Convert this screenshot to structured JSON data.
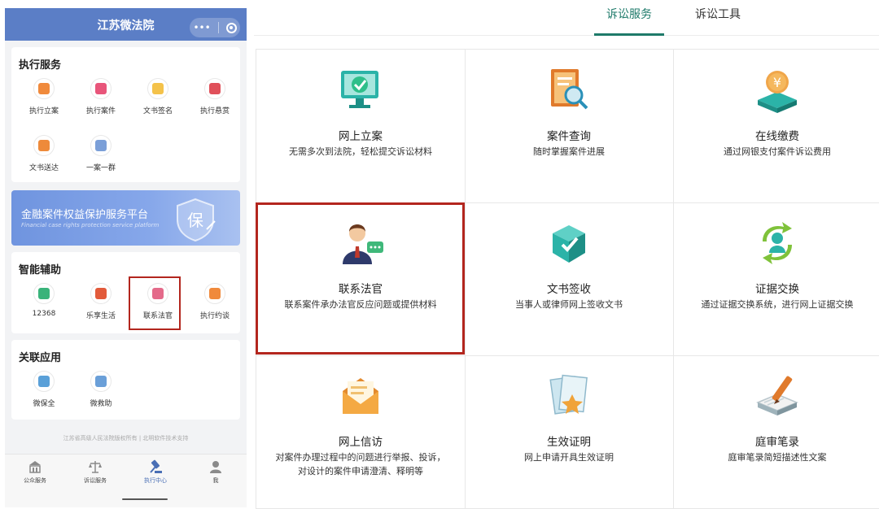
{
  "phone": {
    "title": "江苏微法院",
    "capsule_more": "•••",
    "execution": {
      "title": "执行服务",
      "items": [
        {
          "label": "执行立案",
          "icon": "file-orange-icon",
          "color": "#f08a3c"
        },
        {
          "label": "执行案件",
          "icon": "gavel-pink-icon",
          "color": "#e8557a"
        },
        {
          "label": "文书签名",
          "icon": "document-yellow-icon",
          "color": "#f4c24a"
        },
        {
          "label": "执行悬赏",
          "icon": "reward-red-icon",
          "color": "#e0505a"
        },
        {
          "label": "文书送达",
          "icon": "envelope-orange-icon",
          "color": "#ee8a3a"
        },
        {
          "label": "一案一群",
          "icon": "group-blue-icon",
          "color": "#7b9fd8"
        }
      ]
    },
    "banner": {
      "title": "金融案件权益保护服务平台",
      "subtitle": "Financial case rights protection service platform",
      "shield_char": "保"
    },
    "assist": {
      "title": "智能辅助",
      "items": [
        {
          "label": "12368",
          "icon": "phone-green-icon",
          "color": "#39b37a"
        },
        {
          "label": "乐享生活",
          "icon": "life-red-icon",
          "color": "#e25a3a"
        },
        {
          "label": "联系法官",
          "icon": "judge-pink-icon",
          "color": "#e46a8a"
        },
        {
          "label": "执行约谈",
          "icon": "video-orange-icon",
          "color": "#f08a3c"
        }
      ]
    },
    "related": {
      "title": "关联应用",
      "items": [
        {
          "label": "微保全",
          "icon": "wing-blue-icon",
          "color": "#5aa0d8"
        },
        {
          "label": "微救助",
          "icon": "help-blue-icon",
          "color": "#6a9fd8"
        }
      ]
    },
    "footer_note": "江苏省高级人民法院版权所有 | 北明软件技术支持",
    "tabbar": [
      {
        "label": "公众服务",
        "icon": "building-icon"
      },
      {
        "label": "诉讼服务",
        "icon": "scale-icon"
      },
      {
        "label": "执行中心",
        "icon": "gavel-icon"
      },
      {
        "label": "我",
        "icon": "person-icon"
      }
    ]
  },
  "web": {
    "tabs": [
      {
        "label": "诉讼服务",
        "active": true
      },
      {
        "label": "诉讼工具",
        "active": false
      }
    ],
    "tiles": [
      {
        "title": "网上立案",
        "desc": [
          "无需多次到法院，轻松提交诉讼材料"
        ],
        "icon": "monitor-check-icon"
      },
      {
        "title": "案件查询",
        "desc": [
          "随时掌握案件进展"
        ],
        "icon": "magnifier-doc-icon"
      },
      {
        "title": "在线缴费",
        "desc": [
          "通过网银支付案件诉讼费用"
        ],
        "icon": "yuan-coin-icon"
      },
      {
        "title": "联系法官",
        "desc": [
          "联系案件承办法官反应问题或提供材料"
        ],
        "icon": "judge-chat-icon"
      },
      {
        "title": "文书签收",
        "desc": [
          "当事人或律师网上签收文书"
        ],
        "icon": "box-check-icon"
      },
      {
        "title": "证据交换",
        "desc": [
          "通过证据交换系统，进行网上证据交换"
        ],
        "icon": "exchange-person-icon"
      },
      {
        "title": "网上信访",
        "desc": [
          "对案件办理过程中的问题进行举报、投诉，",
          "对设计的案件申请澄清、释明等"
        ],
        "icon": "open-envelope-icon"
      },
      {
        "title": "生效证明",
        "desc": [
          "网上申请开具生效证明"
        ],
        "icon": "star-certificate-icon"
      },
      {
        "title": "庭审笔录",
        "desc": [
          "庭审笔录简短描述性文案"
        ],
        "icon": "notebook-pen-icon"
      }
    ]
  }
}
